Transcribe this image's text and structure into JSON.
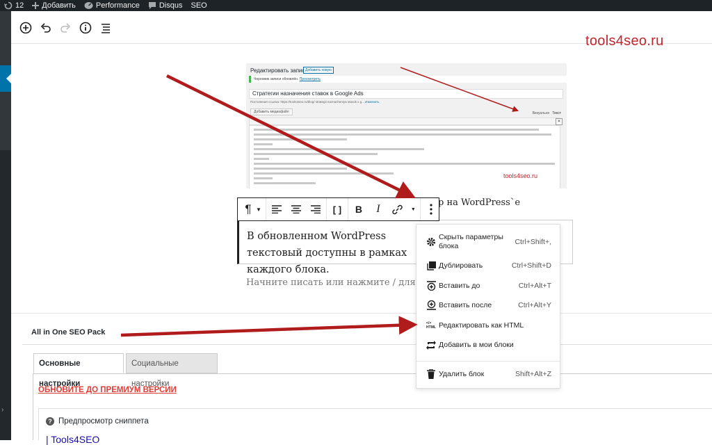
{
  "admin_bar": {
    "updates_count": "12",
    "add_label": "Добавить",
    "performance_label": "Performance",
    "disqus_label": "Disqus",
    "seo_label": "SEO"
  },
  "watermark_brand": "tools4seo.ru",
  "embedded_screenshot": {
    "page_title": "Редактировать запись",
    "add_new": "Добавить новую",
    "notice": "Черновик записи обновлён.",
    "notice_link": "Просмотреть",
    "post_title": "Стратегии назначения ставок в Google Ads",
    "permalink": "Постоянная ссылка: https://tools4seo.ru/blog/ strategii naznacheniya stavok v g...",
    "edit_link": "Изменить",
    "add_media": "Добавить медиафайл",
    "tab_visual": "Визуально",
    "tab_text": "Текст",
    "close": "✕",
    "watermark": "tools4seo.ru"
  },
  "block": {
    "heading_fragment": "р на WordPress`е",
    "paragraph": "В обновленном WordPress текстовый доступны в рамках каждого блока.",
    "placeholder": "Начните писать или нажмите / для вы"
  },
  "menu": {
    "items": [
      {
        "label": "Скрыть параметры блока",
        "shortcut": "Ctrl+Shift+,",
        "icon": "gear-icon"
      },
      {
        "label": "Дублировать",
        "shortcut": "Ctrl+Shift+D",
        "icon": "duplicate-icon"
      },
      {
        "label": "Вставить до",
        "shortcut": "Ctrl+Alt+T",
        "icon": "insert-before-icon"
      },
      {
        "label": "Вставить после",
        "shortcut": "Ctrl+Alt+Y",
        "icon": "insert-after-icon"
      },
      {
        "label": "Редактировать как HTML",
        "shortcut": "",
        "icon": "html-icon"
      },
      {
        "label": "Добавить в мои блоки",
        "shortcut": "",
        "icon": "reusable-block-icon"
      },
      {
        "label": "Удалить блок",
        "shortcut": "Shift+Alt+Z",
        "icon": "trash-icon"
      }
    ]
  },
  "aioseo": {
    "title": "All in One SEO Pack",
    "tabs": [
      "Основные настройки",
      "Социальные настройки"
    ],
    "premium_link": "ОБНОВИТЕ ДО ПРЕМИУМ ВЕРСИИ",
    "snippet_title": "Предпросмотр сниппета",
    "snippet_link": "| Tools4SEO"
  },
  "colors": {
    "admin_bar": "#1d2327",
    "arrow": "#b01c1c",
    "brand": "#c0262d",
    "premium": "#dd3d36"
  }
}
